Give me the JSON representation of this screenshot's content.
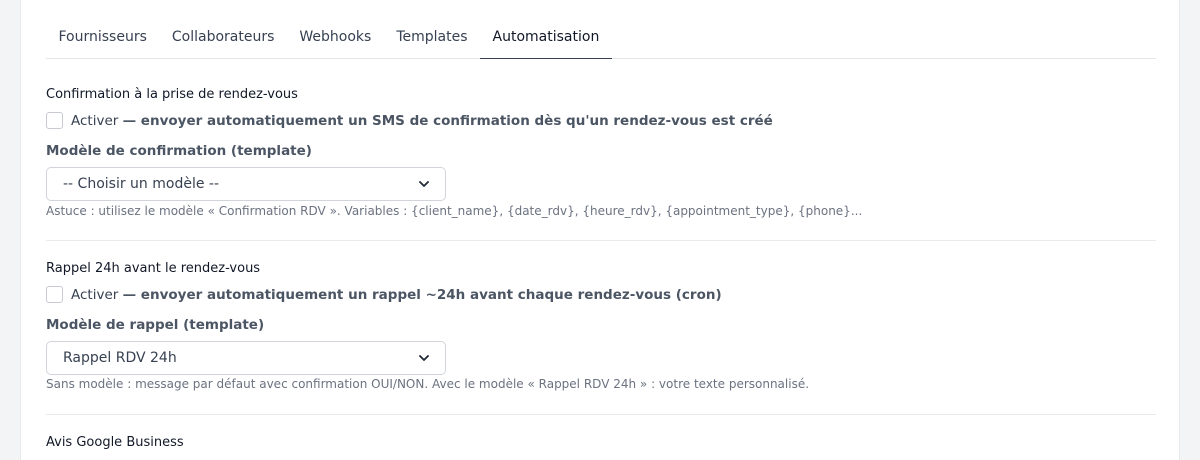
{
  "tabs": [
    {
      "label": "Fournisseurs"
    },
    {
      "label": "Collaborateurs"
    },
    {
      "label": "Webhooks"
    },
    {
      "label": "Templates"
    },
    {
      "label": "Automatisation"
    }
  ],
  "active_tab": "Automatisation",
  "confirmation": {
    "title": "Confirmation à la prise de rendez-vous",
    "activate_label": "Activer",
    "activate_desc": "— envoyer automatiquement un SMS de confirmation dès qu'un rendez-vous est créé",
    "template_label": "Modèle de confirmation (template)",
    "template_value": "-- Choisir un modèle --",
    "hint": "Astuce : utilisez le modèle « Confirmation RDV ». Variables : {client_name}, {date_rdv}, {heure_rdv}, {appointment_type}, {phone}..."
  },
  "reminder": {
    "title": "Rappel 24h avant le rendez-vous",
    "activate_label": "Activer",
    "activate_desc": "— envoyer automatiquement un rappel ~24h avant chaque rendez-vous (cron)",
    "template_label": "Modèle de rappel (template)",
    "template_value": "Rappel RDV 24h",
    "hint": "Sans modèle : message par défaut avec confirmation OUI/NON. Avec le modèle « Rappel RDV 24h » : votre texte personnalisé."
  },
  "google": {
    "title": "Avis Google Business"
  }
}
